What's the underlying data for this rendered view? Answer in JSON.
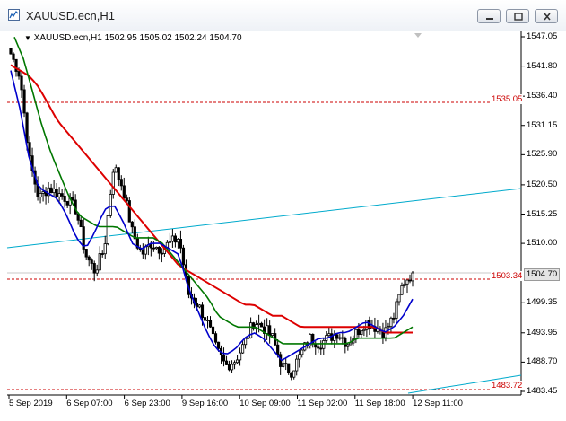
{
  "window": {
    "title": "XAUUSD.ecn,H1",
    "accent": "#0078d7"
  },
  "legend": {
    "text": "XAUUSD.ecn,H1  1502.95 1505.02 1502.24 1504.70"
  },
  "price_axis": {
    "ticks": [
      "1547.05",
      "1541.80",
      "1536.40",
      "1531.15",
      "1525.90",
      "1520.50",
      "1515.25",
      "1510.00",
      "1499.35",
      "1493.95",
      "1488.70",
      "1483.45"
    ]
  },
  "time_axis": {
    "ticks": [
      "5 Sep 2019",
      "6 Sep 07:00",
      "6 Sep 23:00",
      "9 Sep 16:00",
      "10 Sep 09:00",
      "11 Sep 02:00",
      "11 Sep 18:00",
      "12 Sep 11:00"
    ]
  },
  "levels": {
    "upper": "1535.05",
    "current_line": "1503.34",
    "lower": "1483.72",
    "current_price": "1504.70"
  },
  "colors": {
    "candle": "#000000",
    "ma_fast": "#0000cc",
    "ma_mid": "#007700",
    "ma_slow": "#dd0000",
    "trendline": "#00aacc",
    "level_line": "#cc0000"
  },
  "chart_data": {
    "type": "candlestick",
    "symbol": "XAUUSD.ecn",
    "timeframe": "H1",
    "ohlc_last": [
      1502.95,
      1505.02,
      1502.24,
      1504.7
    ],
    "ylim": [
      1483.45,
      1547.05
    ],
    "close_path": [
      1544,
      1540,
      1525,
      1518,
      1520,
      1519,
      1518,
      1516,
      1508,
      1505,
      1509,
      1524,
      1520,
      1512,
      1508,
      1510,
      1509,
      1510,
      1511,
      1501,
      1499,
      1496,
      1491,
      1488,
      1489,
      1492,
      1496,
      1495,
      1493,
      1488,
      1487,
      1490,
      1493,
      1492,
      1493,
      1494,
      1492,
      1494,
      1496,
      1495,
      1494,
      1497,
      1503,
      1504.7
    ],
    "ma_fast": [
      1541,
      1534,
      1525,
      1520,
      1519,
      1518,
      1515,
      1511,
      1509,
      1512,
      1516,
      1517,
      1514,
      1510,
      1509,
      1510,
      1510,
      1509,
      1508,
      1502,
      1498,
      1494,
      1491,
      1490,
      1491,
      1493,
      1494,
      1493,
      1491,
      1489,
      1490,
      1491,
      1492,
      1493,
      1493,
      1494,
      1494,
      1495,
      1496,
      1495,
      1494,
      1495,
      1497,
      1500
    ],
    "ma_mid": [
      1547,
      1543,
      1537,
      1531,
      1526,
      1522,
      1518,
      1515,
      1514,
      1513,
      1513,
      1513,
      1512,
      1511,
      1511,
      1511,
      1510,
      1508,
      1506,
      1504,
      1502,
      1500,
      1497,
      1496,
      1495,
      1495,
      1495,
      1494,
      1493,
      1492,
      1492,
      1492,
      1492,
      1492,
      1492,
      1492,
      1492,
      1493,
      1493,
      1493,
      1493,
      1493,
      1494,
      1495
    ],
    "ma_slow": [
      1542,
      1541,
      1540,
      1538,
      1535,
      1532,
      1530,
      1528,
      1526,
      1524,
      1522,
      1520,
      1518,
      1516,
      1514,
      1512,
      1510,
      1508,
      1506,
      1505,
      1504,
      1503,
      1502,
      1501,
      1500,
      1499,
      1499,
      1498,
      1497,
      1497,
      1496,
      1495,
      1495,
      1495,
      1495,
      1495,
      1495,
      1495,
      1495,
      1495,
      1494,
      1494,
      1494,
      1494
    ]
  }
}
